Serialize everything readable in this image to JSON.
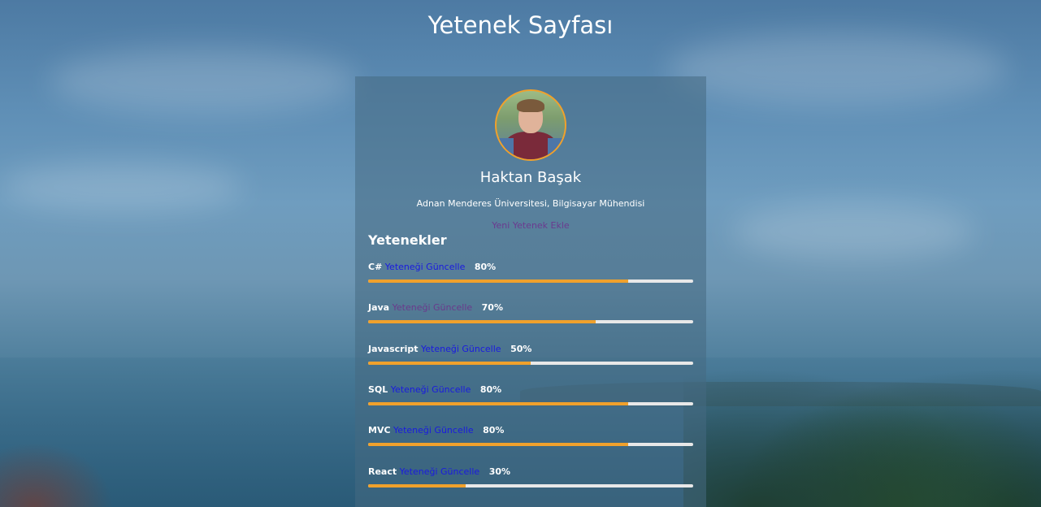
{
  "page": {
    "title": "Yetenek Sayfası"
  },
  "profile": {
    "name": "Haktan Başak",
    "school": "Adnan Menderes Üniversitesi, Bilgisayar Mühendisi",
    "add_skill_label": "Yeni Yetenek Ekle"
  },
  "skills": {
    "heading": "Yetenekler",
    "items": [
      {
        "name": "C#",
        "update_label": "Yeteneği Güncelle",
        "percent_label": "80%",
        "level": 0.8
      },
      {
        "name": "Java",
        "update_label": "Yeteneği Güncelle",
        "percent_label": "70%",
        "level": 0.7
      },
      {
        "name": "Javascript",
        "update_label": "Yeteneği Güncelle",
        "percent_label": "50%",
        "level": 0.5
      },
      {
        "name": "SQL",
        "update_label": "Yeteneği Güncelle",
        "percent_label": "80%",
        "level": 0.8
      },
      {
        "name": "MVC",
        "update_label": "Yeteneği Güncelle",
        "percent_label": "80%",
        "level": 0.8
      },
      {
        "name": "React",
        "update_label": "Yeteneği Güncelle",
        "percent_label": "30%",
        "level": 0.3
      }
    ]
  },
  "colors": {
    "accent": "#f0a12c",
    "link": "#1a1ae0",
    "link_visited": "#6a3a8c",
    "track": "#e8e8e8"
  }
}
